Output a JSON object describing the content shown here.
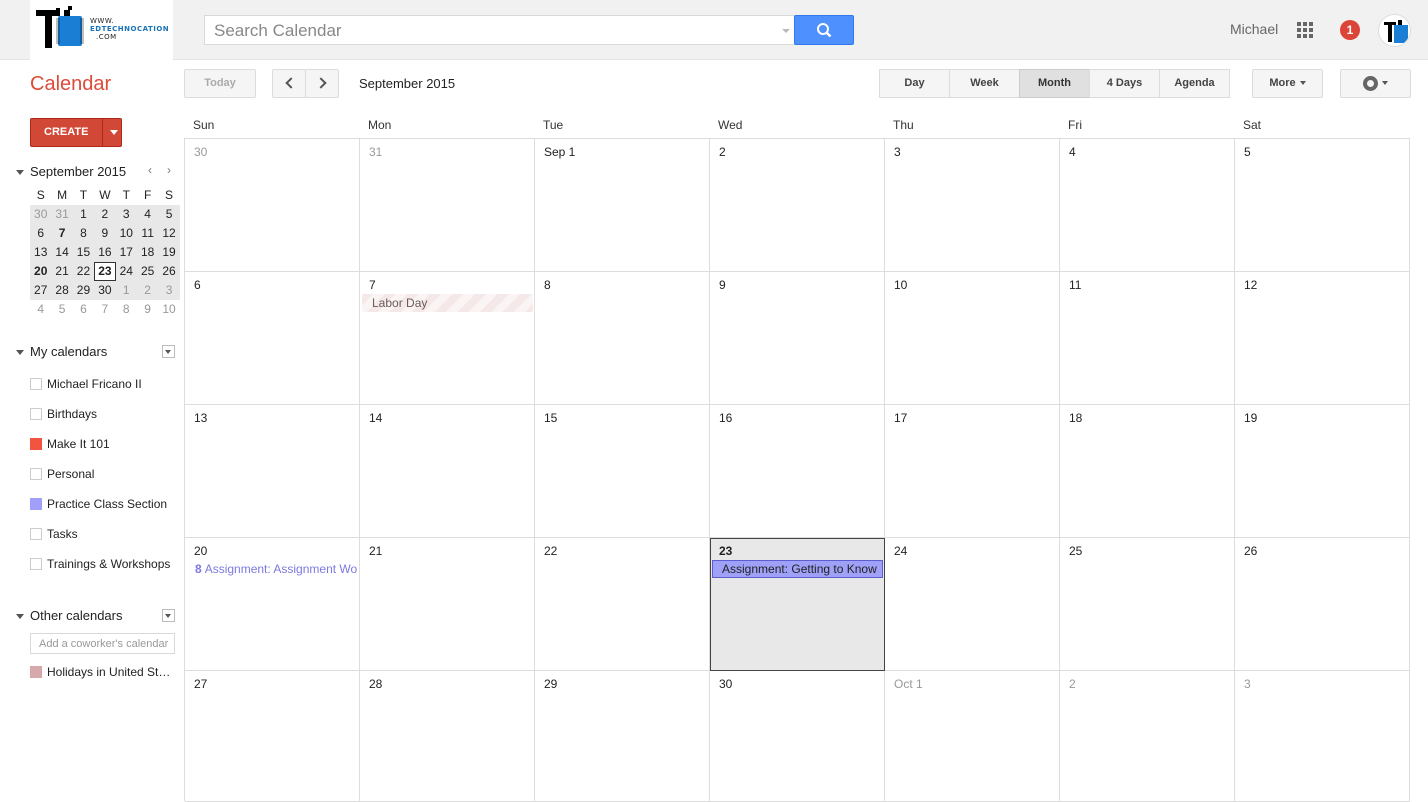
{
  "header": {
    "logo_line1": "WWW.",
    "logo_line2": "EDTECHNOCATION",
    "logo_line3": ".COM",
    "search_placeholder": "Search Calendar",
    "user_name": "Michael",
    "notification_count": "1"
  },
  "toolbar": {
    "app_title": "Calendar",
    "today_label": "Today",
    "date_range": "September 2015",
    "views": [
      "Day",
      "Week",
      "Month",
      "4 Days",
      "Agenda"
    ],
    "active_view": "Month",
    "more_label": "More"
  },
  "sidebar": {
    "create_label": "CREATE",
    "mini_cal_title": "September 2015",
    "mini_cal_dow": [
      "S",
      "M",
      "T",
      "W",
      "T",
      "F",
      "S"
    ],
    "mini_cal_weeks": [
      [
        "30",
        "31",
        "1",
        "2",
        "3",
        "4",
        "5"
      ],
      [
        "6",
        "7",
        "8",
        "9",
        "10",
        "11",
        "12"
      ],
      [
        "13",
        "14",
        "15",
        "16",
        "17",
        "18",
        "19"
      ],
      [
        "20",
        "21",
        "22",
        "23",
        "24",
        "25",
        "26"
      ],
      [
        "27",
        "28",
        "29",
        "30",
        "1",
        "2",
        "3"
      ],
      [
        "4",
        "5",
        "6",
        "7",
        "8",
        "9",
        "10"
      ]
    ],
    "my_calendars_title": "My calendars",
    "my_calendars": [
      {
        "name": "Michael Fricano II",
        "color": ""
      },
      {
        "name": "Birthdays",
        "color": ""
      },
      {
        "name": "Make It 101",
        "color": "#f2553f"
      },
      {
        "name": "Personal",
        "color": ""
      },
      {
        "name": "Practice Class Section",
        "color": "#a0a0f8"
      },
      {
        "name": "Tasks",
        "color": ""
      },
      {
        "name": "Trainings & Workshops",
        "color": ""
      }
    ],
    "other_calendars_title": "Other calendars",
    "add_calendar_placeholder": "Add a coworker's calendar",
    "other_calendars": [
      {
        "name": "Holidays in United States",
        "color": "#d6a8ac"
      }
    ]
  },
  "month": {
    "dow": [
      "Sun",
      "Mon",
      "Tue",
      "Wed",
      "Thu",
      "Fri",
      "Sat"
    ],
    "weeks": [
      [
        "30",
        "31",
        "Sep 1",
        "2",
        "3",
        "4",
        "5"
      ],
      [
        "6",
        "7",
        "8",
        "9",
        "10",
        "11",
        "12"
      ],
      [
        "13",
        "14",
        "15",
        "16",
        "17",
        "18",
        "19"
      ],
      [
        "20",
        "21",
        "22",
        "23",
        "24",
        "25",
        "26"
      ],
      [
        "27",
        "28",
        "29",
        "30",
        "Oct 1",
        "2",
        "3"
      ]
    ],
    "events": {
      "labor_day": "Labor Day",
      "assignment_sun_time": "8",
      "assignment_sun_title": "Assignment: Assignment Wo",
      "assignment_wed_title": "Assignment: Getting to Know"
    }
  }
}
